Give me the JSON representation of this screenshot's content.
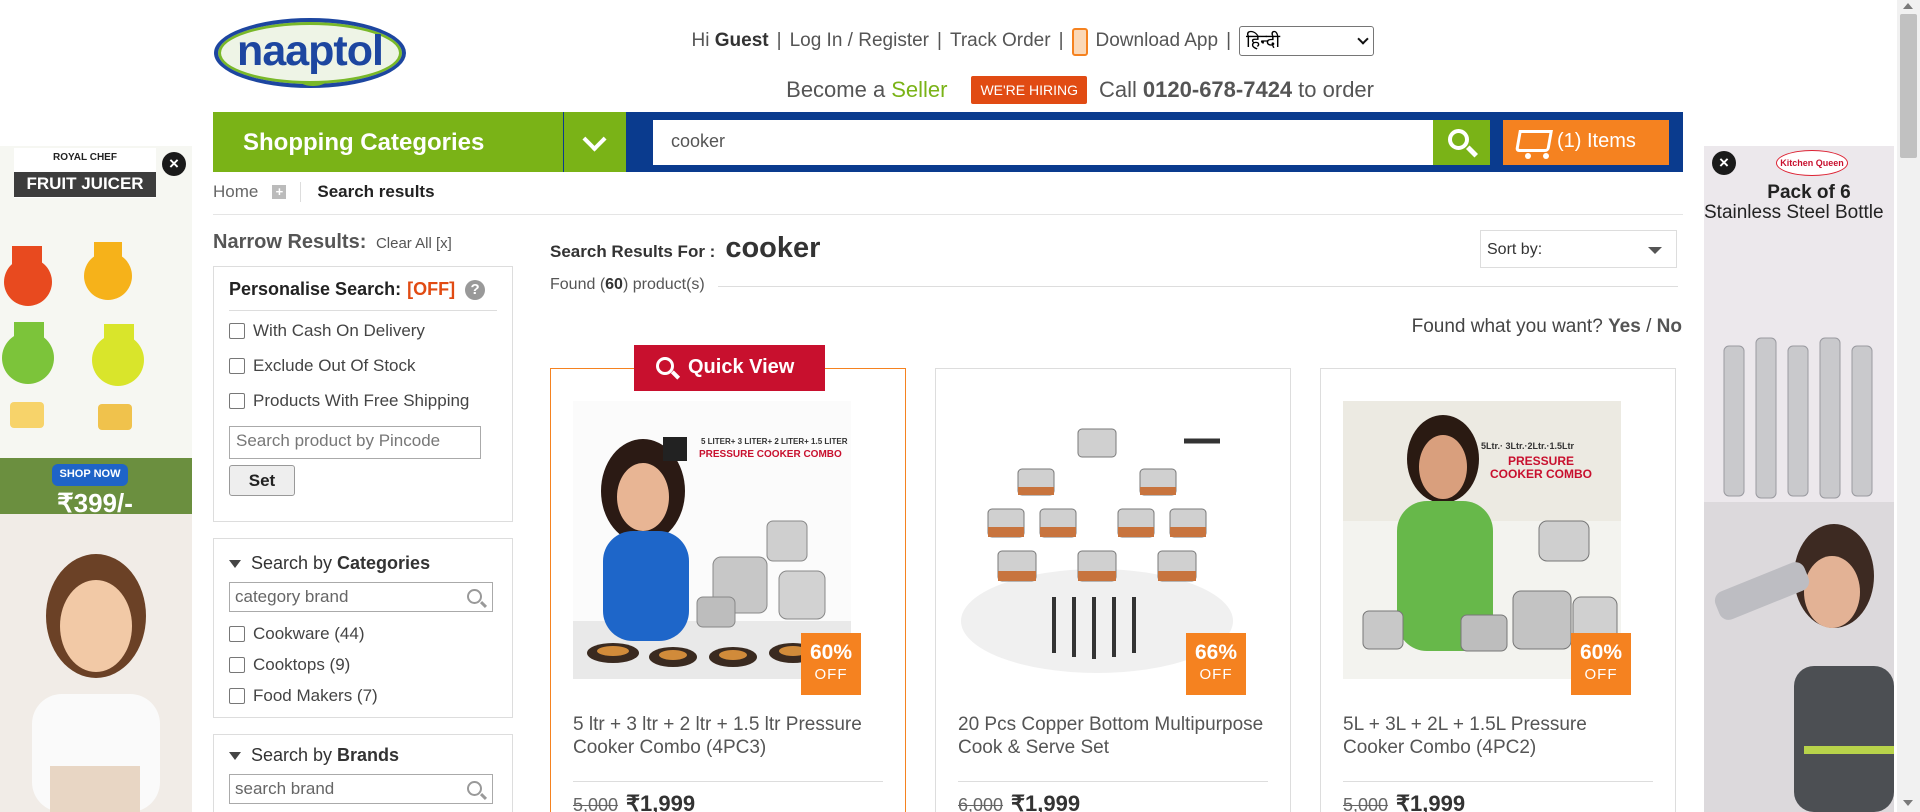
{
  "header": {
    "logo_text": "naaptol",
    "greeting_prefix": "Hi",
    "greeting_user": "Guest",
    "login_label": "Log In / Register",
    "track_label": "Track Order",
    "download_label": "Download App",
    "language": "हिन्दी",
    "become_prefix": "Become a",
    "seller_label": "Seller",
    "hiring_label": "WE'RE HIRING",
    "call_prefix": "Call",
    "phone": "0120-678-7424",
    "call_suffix": "to order"
  },
  "nav": {
    "categories_label": "Shopping Categories",
    "search_value": "cooker",
    "cart_label": "(1) Items"
  },
  "breadcrumb": {
    "home": "Home",
    "current": "Search results"
  },
  "sidebar": {
    "narrow_label": "Narrow Results:",
    "clear_label": "Clear All [x]",
    "personalise_label": "Personalise Search:",
    "personalise_state": "[OFF]",
    "help": "?",
    "options": [
      "With Cash On Delivery",
      "Exclude Out Of Stock",
      "Products With Free Shipping"
    ],
    "pincode_placeholder": "Search product by Pincode",
    "set_label": "Set",
    "categories_prefix": "Search by",
    "categories_title": "Categories",
    "category_placeholder": "category brand",
    "categories": [
      "Cookware (44)",
      "Cooktops (9)",
      "Food Makers (7)"
    ],
    "brands_prefix": "Search by",
    "brands_title": "Brands",
    "brand_placeholder": "search brand"
  },
  "results": {
    "title_label": "Search Results For :",
    "query": "cooker",
    "found_prefix": "Found (",
    "found_count": "60",
    "found_suffix": ") product(s)",
    "sort_label": "Sort by:",
    "feedback_question": "Found what you want?",
    "yes": "Yes",
    "slash": "/",
    "no": "No",
    "quick_view": "Quick View",
    "products": [
      {
        "name": "5 ltr + 3 ltr + 2 ltr + 1.5 ltr Pressure Cooker Combo (4PC3)",
        "discount": "60%",
        "off": "OFF",
        "mrp": "5,000",
        "price": "₹1,999",
        "banner": "5 LITER+ 3 LITER+ 2 LITER+ 1.5 LITER",
        "banner2": "PRESSURE COOKER COMBO"
      },
      {
        "name": "20 Pcs Copper Bottom Multipurpose Cook & Serve Set",
        "discount": "66%",
        "off": "OFF",
        "mrp": "6,000",
        "price": "₹1,999"
      },
      {
        "name": "5L + 3L + 2L + 1.5L Pressure Cooker Combo (4PC2)",
        "discount": "60%",
        "off": "OFF",
        "mrp": "5,000",
        "price": "₹1,999",
        "banner": "5Ltr.· 3Ltr.·2Ltr.·1.5Ltr",
        "banner2": "PRESSURE COOKER COMBO"
      }
    ]
  },
  "ads": {
    "left_brand": "ROYAL CHEF",
    "left_title": "FRUIT JUICER",
    "left_cta": "SHOP NOW",
    "left_price": "₹399/-",
    "right_brand": "Kitchen Queen",
    "right_title": "Pack of 6",
    "right_subtitle": "Stainless Steel Bottle",
    "close": "×"
  },
  "colors": {
    "green": "#7ab317",
    "blue": "#0a3b8e",
    "orange": "#f58220",
    "red": "#c8102e"
  }
}
